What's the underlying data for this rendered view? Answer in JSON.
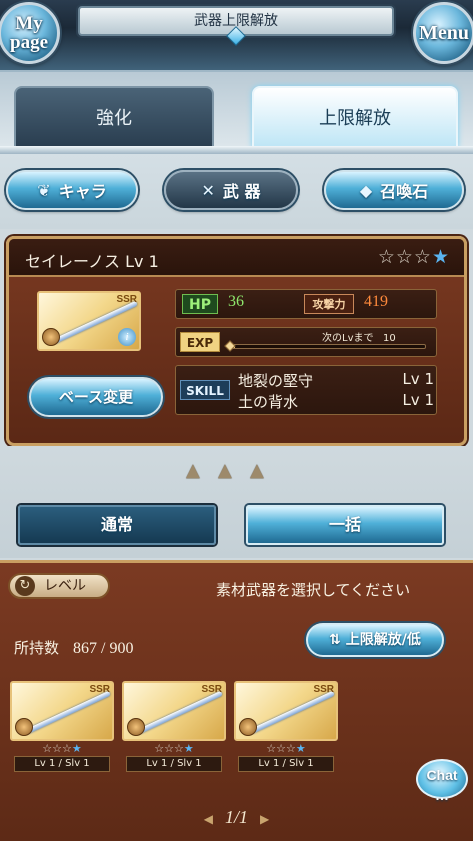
{
  "header": {
    "title": "武器上限解放",
    "mypage_line1": "My",
    "mypage_line2": "page",
    "menu_label": "Menu"
  },
  "tabs": [
    {
      "label": "強化",
      "active": false
    },
    {
      "label": "上限解放",
      "active": true
    }
  ],
  "categories": [
    {
      "label": "キャラ",
      "icon": "chara-icon"
    },
    {
      "label": "武 器",
      "icon": "swords-icon",
      "active": true
    },
    {
      "label": "召喚石",
      "icon": "summon-crystal-icon"
    }
  ],
  "weapon": {
    "name": "セイレーノス Lv 1",
    "stars_filled": 0,
    "stars_total": 4,
    "rarity": "SSR",
    "hp_label": "HP",
    "hp": "36",
    "atk_label": "攻撃力",
    "atk": "419",
    "exp_label": "EXP",
    "next_lv_text": "次のLvまで",
    "next_lv_value": "10",
    "exp_progress": 0.02,
    "skill_label": "SKILL",
    "skills": [
      {
        "name": "地裂の堅守",
        "level": "Lv 1"
      },
      {
        "name": "土の背水",
        "level": "Lv 1"
      }
    ],
    "base_change_label": "ベース変更"
  },
  "modes": {
    "normal_label": "通常",
    "bulk_label": "一括"
  },
  "materials": {
    "sort_label": "レベル",
    "prompt": "素材武器を選択してください",
    "owned_label": "所持数",
    "owned_value": "867 / 900",
    "limit_low_label": "上限解放/低",
    "items": [
      {
        "rarity": "SSR",
        "level": "Lv 1 / Slv 1"
      },
      {
        "rarity": "SSR",
        "level": "Lv 1 / Slv 1"
      },
      {
        "rarity": "SSR",
        "level": "Lv 1 / Slv 1"
      }
    ],
    "chat_label": "Chat",
    "pager": "1/1"
  },
  "colors": {
    "panel_brown": "#6a3019",
    "accent_blue": "#4fb0d8",
    "hp_green": "#8fe86d",
    "atk_orange": "#ff8a3c"
  }
}
